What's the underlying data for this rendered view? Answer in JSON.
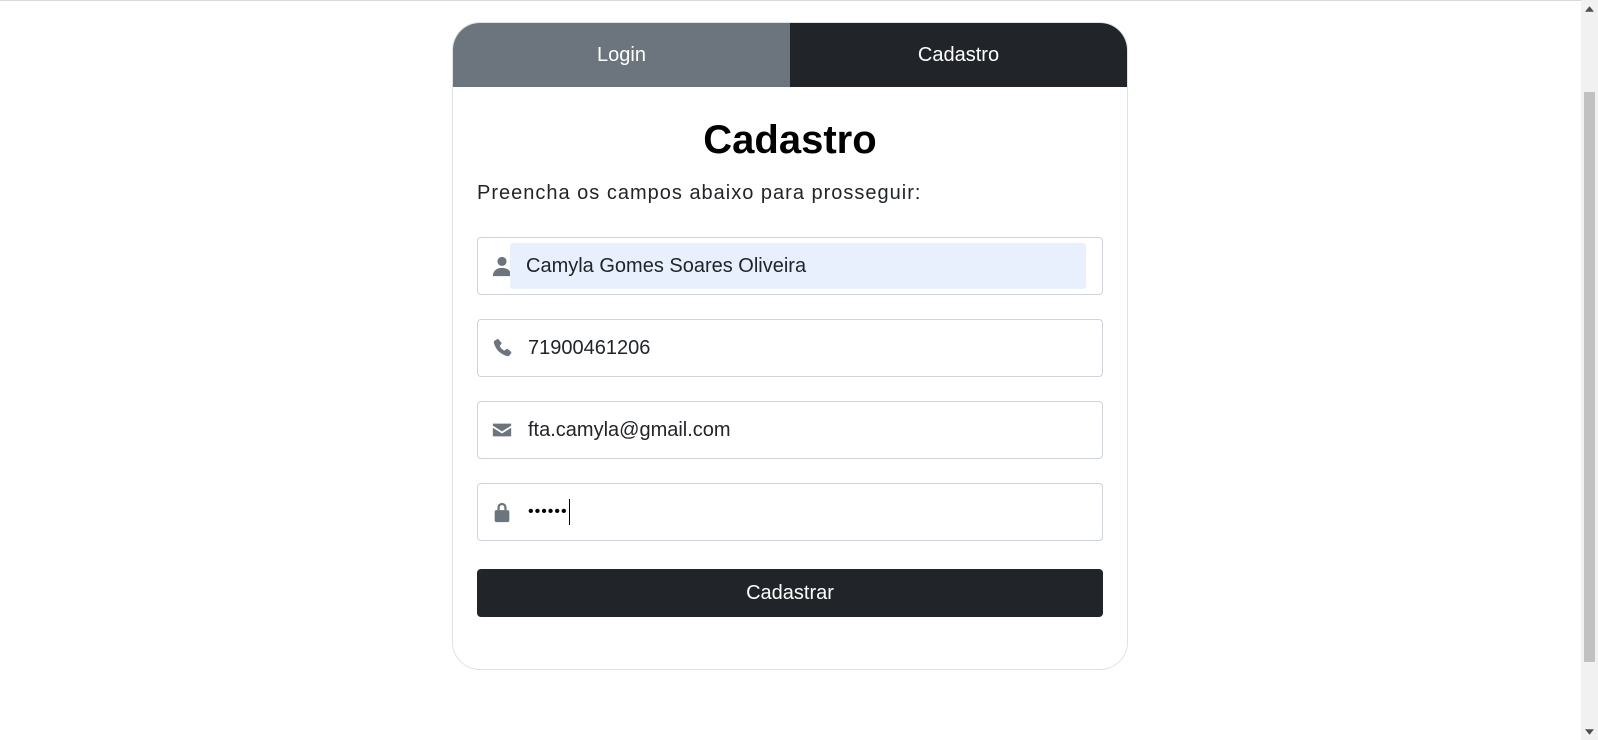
{
  "tabs": {
    "login": "Login",
    "cadastro": "Cadastro"
  },
  "form": {
    "title": "Cadastro",
    "subtitle": "Preencha os campos abaixo para prosseguir:",
    "name_value": "Camyla Gomes Soares Oliveira",
    "phone_value": "71900461206",
    "email_value": "fta.camyla@gmail.com",
    "password_value": "••••••",
    "submit_label": "Cadastrar"
  },
  "icons": {
    "name": "user-icon",
    "phone": "phone-icon",
    "email": "envelope-icon",
    "password": "lock-icon"
  },
  "colors": {
    "active_tab": "#212529",
    "inactive_tab": "#6c757d",
    "autofill_bg": "#e8f0fe",
    "button": "#212529"
  }
}
